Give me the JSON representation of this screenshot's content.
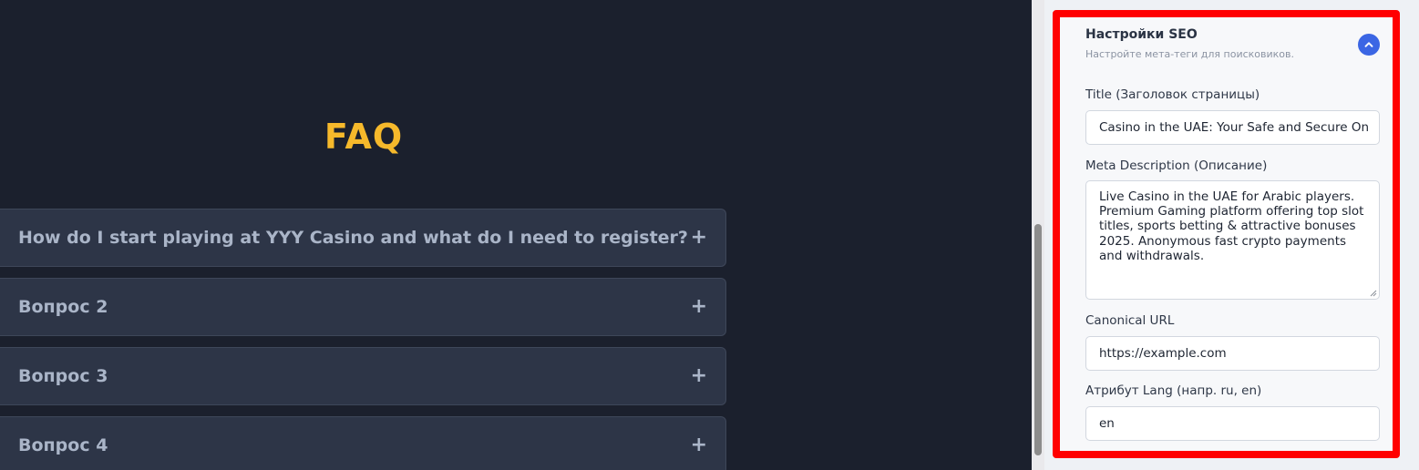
{
  "faq": {
    "title": "FAQ",
    "items": [
      {
        "question": "How do I start playing at YYY Casino and what do I need to register?",
        "toggle": "+"
      },
      {
        "question": "Вопрос 2",
        "toggle": "+"
      },
      {
        "question": "Вопрос 3",
        "toggle": "+"
      },
      {
        "question": "Вопрос 4",
        "toggle": "+"
      }
    ]
  },
  "seo": {
    "title": "Настройки SEO",
    "subtitle": "Настройте мета-теги для поисковиков.",
    "collapse_icon": "chevron-up-icon",
    "accent_color": "#3b66e4",
    "highlight_color": "#ff0000",
    "fields": {
      "title_label": "Title (Заголовок страницы)",
      "title_value": "Casino in the UAE: Your Safe and Secure On",
      "description_label": "Meta Description (Описание)",
      "description_value": "Live Casino in the UAE for Arabic players. Premium Gaming platform offering top slot titles, sports betting & attractive bonuses 2025. Anonymous fast crypto payments and withdrawals.",
      "canonical_label": "Canonical URL",
      "canonical_value": "https://example.com",
      "lang_label": "Атрибут Lang (напр. ru, en)",
      "lang_value": "en"
    }
  },
  "colors": {
    "background": "#1b202d",
    "faq_title": "#f6b92b",
    "faq_item_bg": "#2d3547"
  }
}
